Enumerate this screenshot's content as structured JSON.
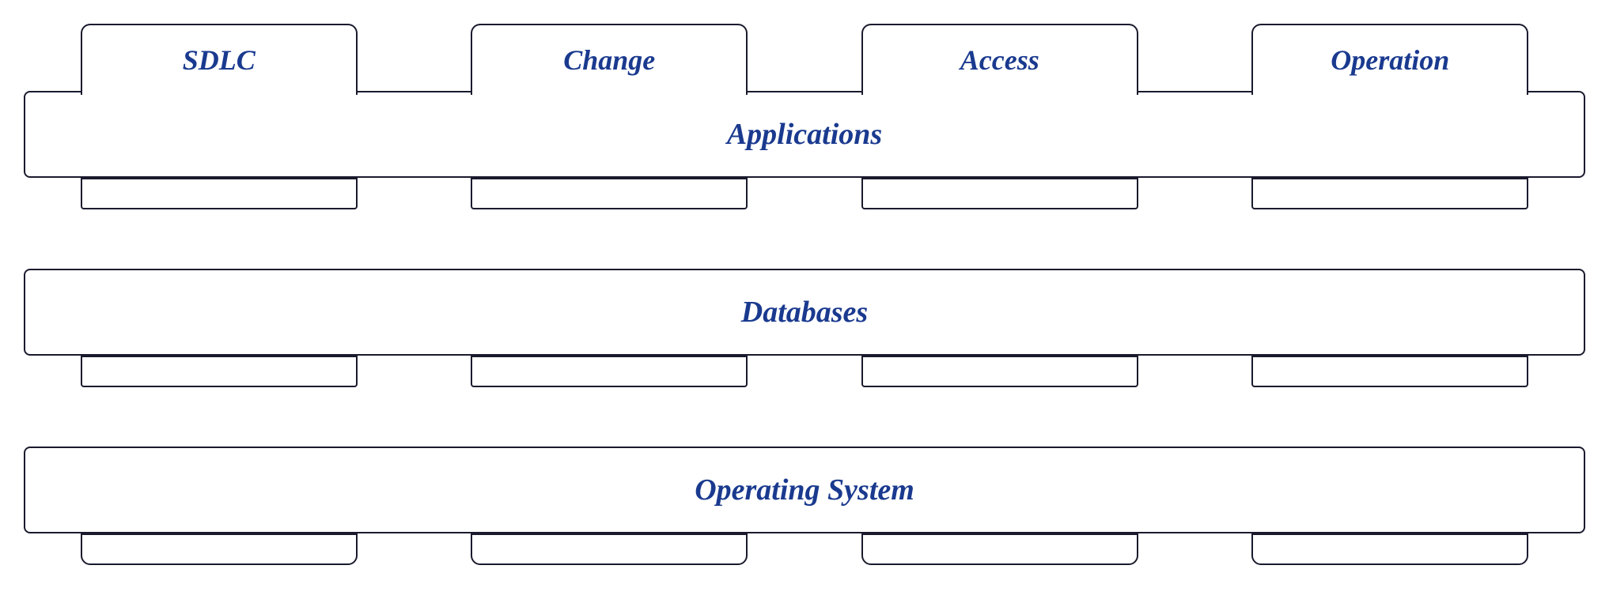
{
  "tabs": [
    {
      "id": "sdlc",
      "label": "SDLC"
    },
    {
      "id": "change",
      "label": "Change"
    },
    {
      "id": "access",
      "label": "Access"
    },
    {
      "id": "operation",
      "label": "Operation"
    }
  ],
  "bands": [
    {
      "id": "applications",
      "label": "Applications"
    },
    {
      "id": "databases",
      "label": "Databases"
    },
    {
      "id": "operating-system",
      "label": "Operating System"
    }
  ],
  "colors": {
    "border": "#1a1a2e",
    "text": "#1a3a8f",
    "background": "#ffffff"
  }
}
